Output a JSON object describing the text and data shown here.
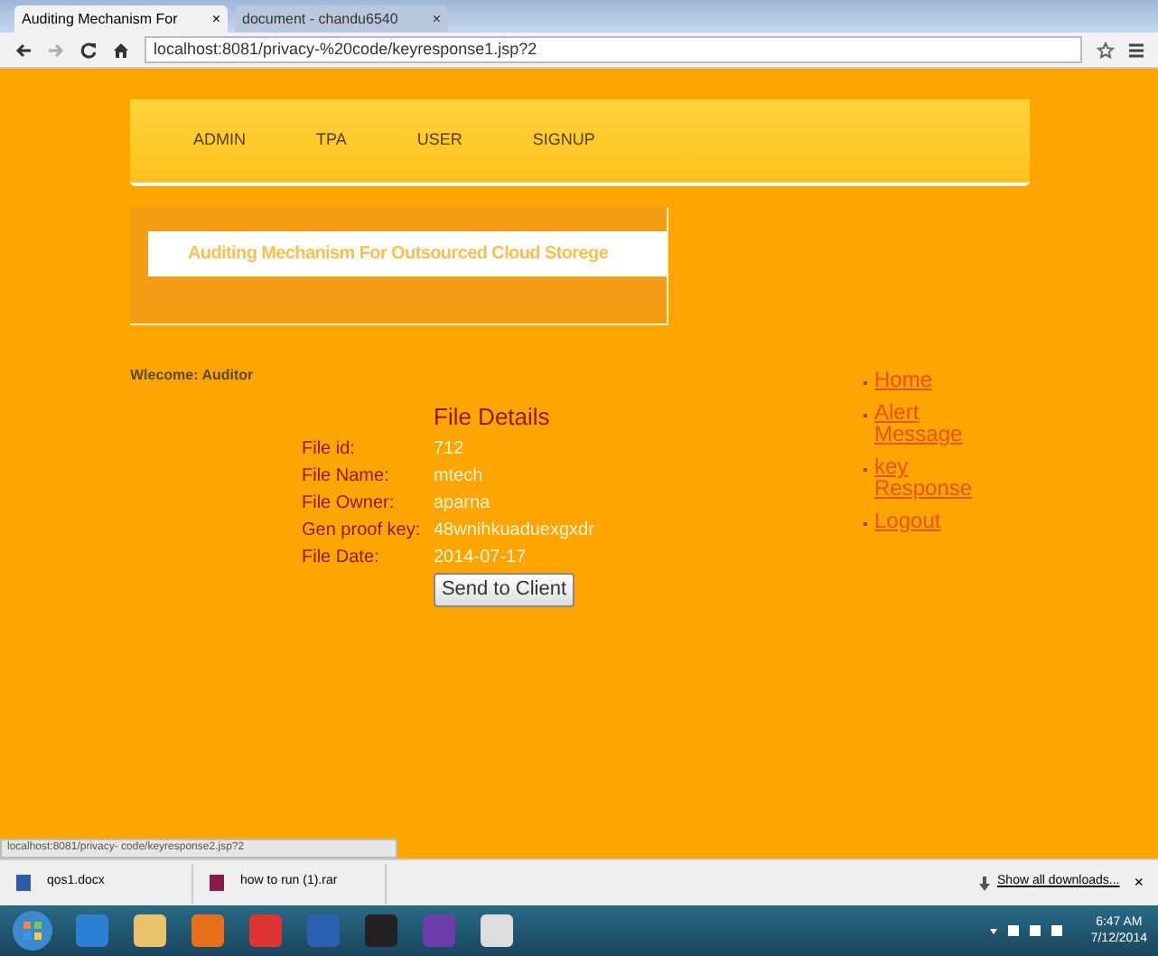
{
  "browser": {
    "tabs": [
      {
        "title": "Auditing Mechanism For",
        "close": "×",
        "selected": true
      },
      {
        "title": "document - chandu6540",
        "close": "×",
        "selected": false
      }
    ],
    "url": "localhost:8081/privacy-%20code/keyresponse1.jsp?2"
  },
  "nav": [
    {
      "label": "ADMIN"
    },
    {
      "label": "TPA"
    },
    {
      "label": "USER"
    },
    {
      "label": "SIGNUP"
    }
  ],
  "banner": "Auditing Mechanism For Outsourced Cloud Storege",
  "welcome": "Wlecome: Auditor",
  "details": {
    "title": "File Details",
    "rows": [
      {
        "label": "File id:",
        "value": "712"
      },
      {
        "label": "File Name:",
        "value": "mtech"
      },
      {
        "label": "File Owner:",
        "value": "aparna"
      },
      {
        "label": "Gen proof key:",
        "value": "48wnihkuaduexgxdr"
      },
      {
        "label": "File Date:",
        "value": "2014-07-17"
      }
    ],
    "button": "Send to Client"
  },
  "links": [
    "Home",
    "Alert Message",
    "key Response",
    "Logout"
  ],
  "status_url": "localhost:8081/privacy- code/keyresponse2.jsp?2",
  "downloads": {
    "items": [
      "qos1.docx",
      "how to run (1).rar"
    ],
    "show_all": "Show all downloads...",
    "close": "×"
  },
  "taskbar": {
    "time": "6:47 AM",
    "date": "7/12/2014"
  }
}
